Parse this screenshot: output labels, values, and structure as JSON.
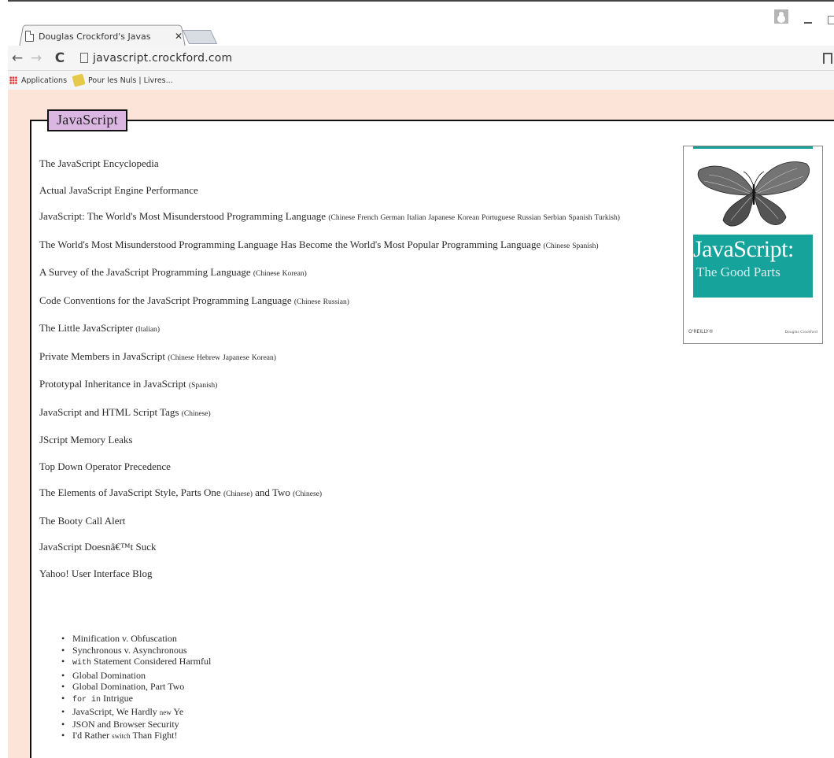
{
  "browser": {
    "tab_title": "Douglas Crockford's Javas",
    "tab_close": "✕",
    "url": "javascript.crockford.com",
    "nav": {
      "back": "←",
      "forward": "→",
      "reload": "C"
    },
    "bookmarks": [
      {
        "label": "Applications"
      },
      {
        "label": "Pour les Nuls | Livres..."
      }
    ]
  },
  "page": {
    "legend": "JavaScript",
    "entries": [
      {
        "title": "The JavaScript Encyclopedia",
        "langs": []
      },
      {
        "title": "Actual JavaScript Engine Performance",
        "langs": []
      },
      {
        "title": "JavaScript: The World's Most Misunderstood Programming Language",
        "langs": [
          "Chinese",
          "French",
          "German",
          "Italian",
          "Japanese",
          "Korean",
          "Portuguese",
          "Russian",
          "Serbian",
          "Spanish",
          "Turkish"
        ]
      },
      {
        "title": "The World's Most Misunderstood Programming Language Has Become the World's Most Popular Programming Language",
        "langs": [
          "Chinese",
          "Spanish"
        ]
      },
      {
        "title": "A Survey of the JavaScript Programming Language",
        "langs": [
          "Chinese",
          "Korean"
        ]
      },
      {
        "title": "Code Conventions for the JavaScript Programming Language",
        "langs": [
          "Chinese",
          "Russian"
        ]
      },
      {
        "title": "The Little JavaScripter",
        "langs": [
          "Italian"
        ]
      },
      {
        "title": "Private Members in JavaScript",
        "langs": [
          "Chinese",
          "Hebrew",
          "Japanese",
          "Korean"
        ]
      },
      {
        "title": "Prototypal Inheritance in JavaScript",
        "langs": [
          "Spanish"
        ]
      },
      {
        "title": "JavaScript and HTML Script Tags",
        "langs": [
          "Chinese"
        ]
      },
      {
        "title": "JScript Memory Leaks",
        "langs": []
      },
      {
        "title": "Top Down Operator Precedence",
        "langs": []
      },
      {
        "title_a": "The Elements of JavaScript Style, Parts One",
        "lang_a": "Chinese",
        "mid": "and Two",
        "lang_b": "Chinese"
      },
      {
        "title": "The Booty Call Alert",
        "langs": []
      },
      {
        "title": "JavaScript Doesnâ€™t Suck",
        "langs": []
      },
      {
        "title": "Yahoo! User Interface Blog",
        "langs": []
      }
    ],
    "blog_posts": [
      {
        "text": "Minification v. Obfuscation"
      },
      {
        "text": "Synchronous v. Asynchronous"
      },
      {
        "code": "with",
        "text": "Statement Considered Harmful"
      },
      {
        "text": "Global Domination"
      },
      {
        "text": "Global Domination, Part Two"
      },
      {
        "code": "for in",
        "text": "Intrigue"
      },
      {
        "text": "JavaScript, We Hardly",
        "small": "new",
        "text2": "Ye"
      },
      {
        "text": "JSON and Browser Security"
      },
      {
        "text": "I'd Rather",
        "small": "switch",
        "text2": "Than Fight!"
      }
    ]
  },
  "book": {
    "title": "JavaScript:",
    "subtitle": "The Good Parts",
    "publisher": "O'REILLY®",
    "author": "Douglas Crockford",
    "accent_color": "#16a39b"
  }
}
